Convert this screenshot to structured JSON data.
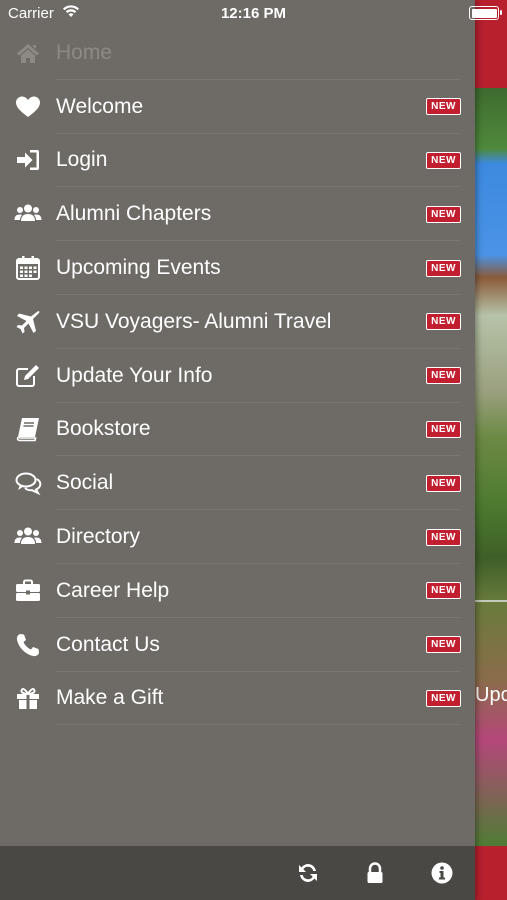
{
  "status_bar": {
    "carrier": "Carrier",
    "time": "12:16 PM"
  },
  "menu": {
    "items": [
      {
        "label": "Home",
        "icon": "home-icon",
        "badge": ""
      },
      {
        "label": "Welcome",
        "icon": "heart-icon",
        "badge": "NEW"
      },
      {
        "label": "Login",
        "icon": "sign-in-icon",
        "badge": "NEW"
      },
      {
        "label": "Alumni Chapters",
        "icon": "users-icon",
        "badge": "NEW"
      },
      {
        "label": "Upcoming Events",
        "icon": "calendar-icon",
        "badge": "NEW"
      },
      {
        "label": "VSU Voyagers- Alumni Travel",
        "icon": "plane-icon",
        "badge": "NEW"
      },
      {
        "label": "Update Your Info",
        "icon": "edit-icon",
        "badge": "NEW"
      },
      {
        "label": "Bookstore",
        "icon": "book-icon",
        "badge": "NEW"
      },
      {
        "label": "Social",
        "icon": "chat-icon",
        "badge": "NEW"
      },
      {
        "label": "Directory",
        "icon": "users-icon",
        "badge": "NEW"
      },
      {
        "label": "Career Help",
        "icon": "briefcase-icon",
        "badge": "NEW"
      },
      {
        "label": "Contact Us",
        "icon": "phone-icon",
        "badge": "NEW"
      },
      {
        "label": "Make a Gift",
        "icon": "gift-icon",
        "badge": "NEW"
      }
    ]
  },
  "bottom_bar": {
    "buttons": [
      "refresh-icon",
      "lock-icon",
      "info-icon"
    ]
  },
  "background": {
    "partial_text": "Upo"
  },
  "colors": {
    "drawer": "#6e6b66",
    "badge": "#c11f2f",
    "bottom_bar": "#4a4845",
    "brand_red": "#b8202e"
  }
}
